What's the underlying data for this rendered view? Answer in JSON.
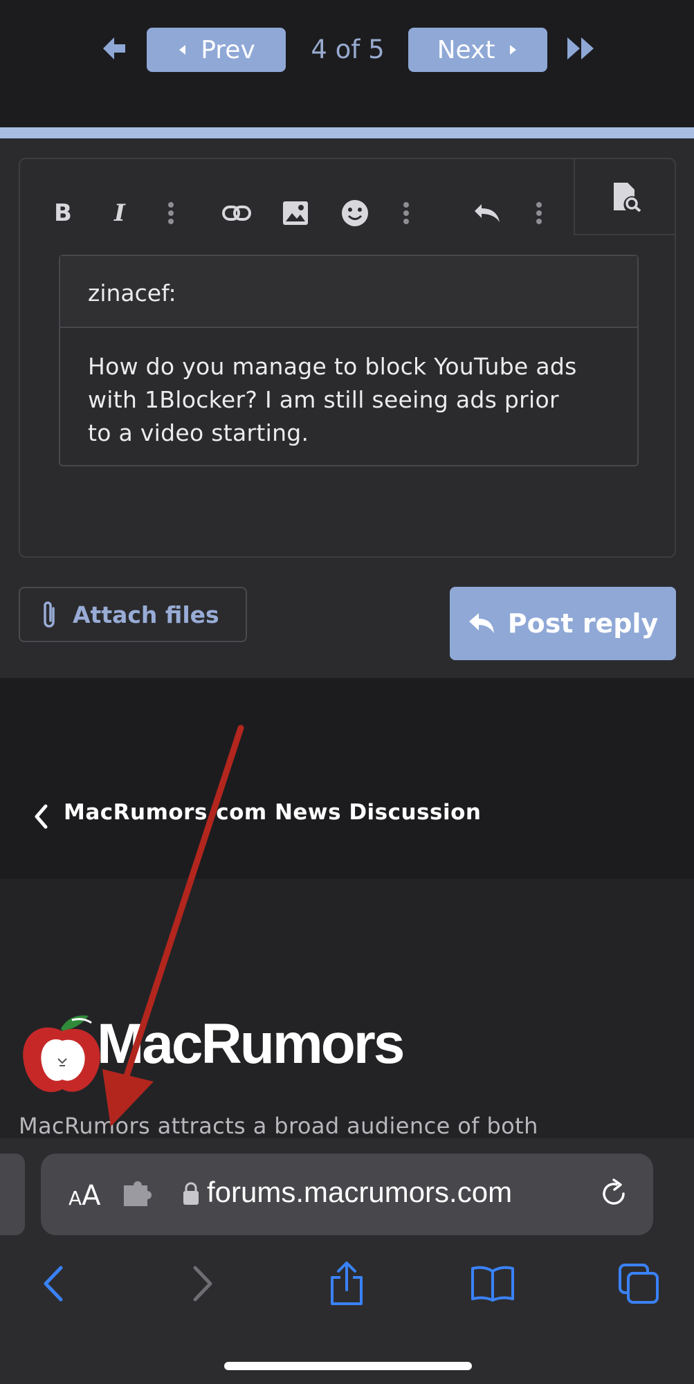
{
  "pagination": {
    "prev_label": "Prev",
    "page_status": "4 of 5",
    "next_label": "Next"
  },
  "editor": {
    "toolbar_icons": [
      "bold-icon",
      "italic-icon",
      "more-icon",
      "link-icon",
      "image-icon",
      "emoji-icon",
      "more-icon",
      "undo-icon",
      "more-icon",
      "preview-icon"
    ],
    "quote_author": "zinacef:",
    "quote_lines": [
      "How do you manage to block YouTube ads",
      "with 1Blocker?  I am still seeing ads prior",
      "to a video starting."
    ]
  },
  "actions": {
    "attach_label": "Attach files",
    "post_label": "Post reply"
  },
  "breadcrumb": {
    "label": "MacRumors.com News Discussion"
  },
  "footer": {
    "logo_text": "MacRumors",
    "tagline": "MacRumors attracts a broad audience of both"
  },
  "browser": {
    "text_size_label_small": "A",
    "text_size_label_large": "A",
    "url": "forums.macrumors.com"
  },
  "colors": {
    "accent": "#8fa8d6",
    "page_bg": "#1c1c1f",
    "panel_bg": "#2b2b2e",
    "safari_blue": "#3a82f7",
    "annotation_arrow": "#b3261e"
  }
}
